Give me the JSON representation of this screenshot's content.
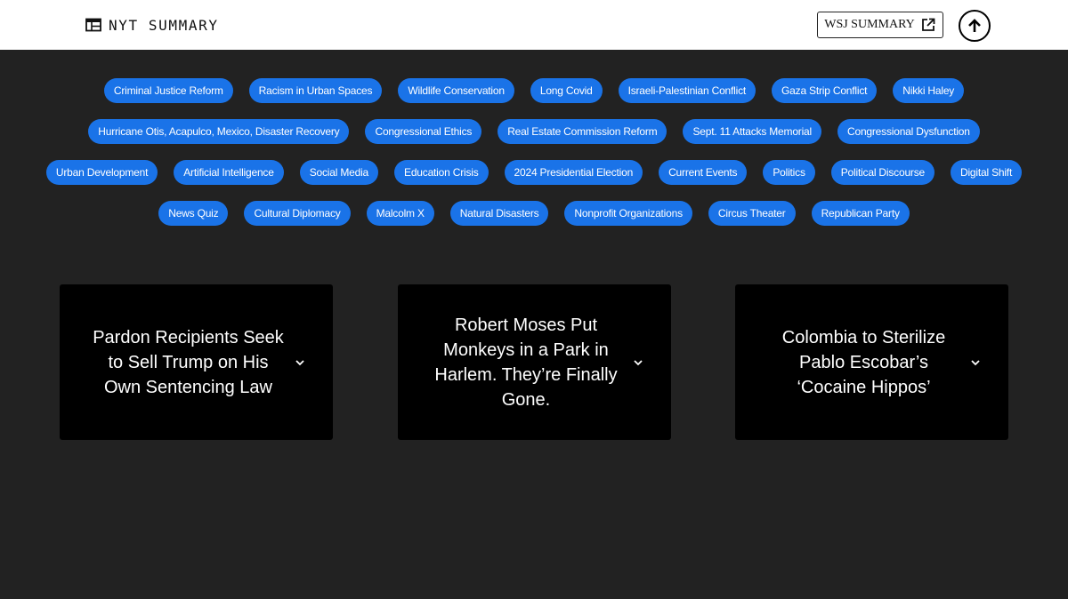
{
  "header": {
    "title": "NYT SUMMARY",
    "brand_icon": "newspaper-icon",
    "wsj_label": "WSJ SUMMARY",
    "wsj_icon": "external-link-icon",
    "scroll_top_icon": "arrow-up-circle-icon"
  },
  "tags": [
    "Criminal Justice Reform",
    "Racism in Urban Spaces",
    "Wildlife Conservation",
    "Long Covid",
    "Israeli-Palestinian Conflict",
    "Gaza Strip Conflict",
    "Nikki Haley",
    "Hurricane Otis, Acapulco, Mexico, Disaster Recovery",
    "Congressional Ethics",
    "Real Estate Commission Reform",
    "Sept. 11 Attacks Memorial",
    "Congressional Dysfunction",
    "Urban Development",
    "Artificial Intelligence",
    "Social Media",
    "Education Crisis",
    "2024 Presidential Election",
    "Current Events",
    "Politics",
    "Political Discourse",
    "Digital Shift",
    "News Quiz",
    "Cultural Diplomacy",
    "Malcolm X",
    "Natural Disasters",
    "Nonprofit Organizations",
    "Circus Theater",
    "Republican Party"
  ],
  "articles": [
    {
      "title": "Pardon Recipients Seek to Sell Trump on His Own Sentencing Law"
    },
    {
      "title": "Robert Moses Put Monkeys in a Park in Harlem. They’re Finally Gone."
    },
    {
      "title": "Colombia to Sterilize Pablo Escobar’s ‘Cocaine Hippos’"
    }
  ],
  "colors": {
    "background": "#222222",
    "header": "#ffffff",
    "tag": "#1a73e8",
    "card": "#000000"
  }
}
